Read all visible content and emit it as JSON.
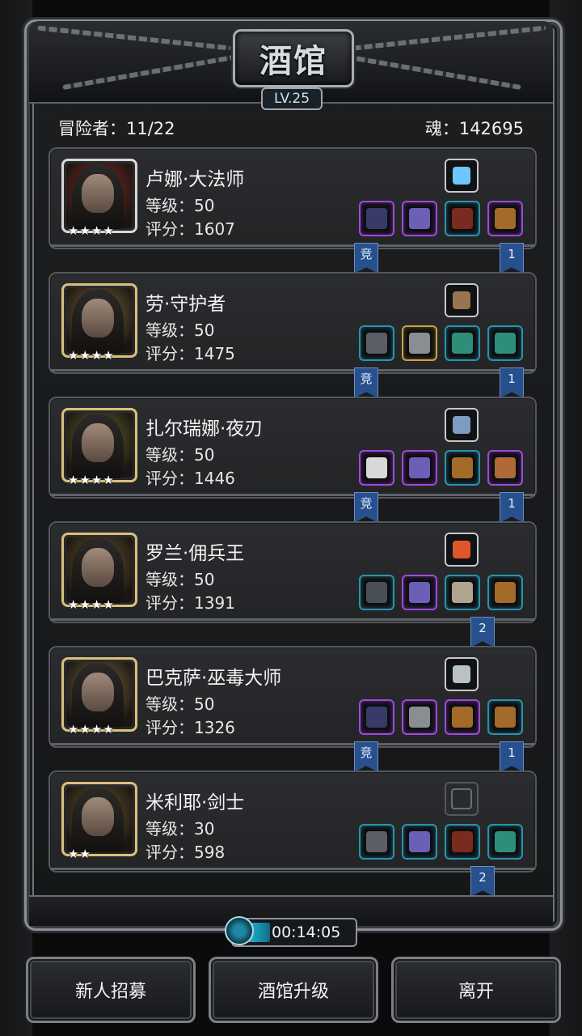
{
  "title": "酒馆",
  "tavern_level": "LV.25",
  "adventurers_label": "冒险者：11/22",
  "soul_label": "魂：142695",
  "stars_glyph": "★",
  "tags": {
    "arena": "竞"
  },
  "heroes": [
    {
      "name": "卢娜·大法师",
      "level": "等级：50",
      "score": "评分：1607",
      "stars": "★★★★",
      "portrait_bg": "#8a2a22",
      "frame_color": "#d8d8d8",
      "skill": "ice-crystal-icon",
      "skill_color": "#6ec6ff",
      "equip": [
        {
          "rarity": "purple",
          "icon": "staff-icon",
          "color": "#3a3a6a"
        },
        {
          "rarity": "purple",
          "icon": "armor-icon",
          "color": "#6b5fb8"
        },
        {
          "rarity": "teal",
          "icon": "amulet-icon",
          "color": "#7a2a1f"
        },
        {
          "rarity": "purple",
          "icon": "chest-icon",
          "color": "#a36a2a"
        }
      ],
      "arena_tag": true,
      "rank_tag": "1"
    },
    {
      "name": "劳·守护者",
      "level": "等级：50",
      "score": "评分：1475",
      "stars": "★★★★",
      "portrait_bg": "#7a6a3a",
      "frame_color": "#d9c07a",
      "skill": "gauntlet-icon",
      "skill_color": "#9a7450",
      "equip": [
        {
          "rarity": "teal",
          "icon": "sword-icon",
          "color": "#5a5f66"
        },
        {
          "rarity": "gold",
          "icon": "armor-icon",
          "color": "#8a8d92"
        },
        {
          "rarity": "teal",
          "icon": "ring-icon",
          "color": "#2f8e7a"
        },
        {
          "rarity": "teal",
          "icon": "ring-icon",
          "color": "#2f8e7a"
        }
      ],
      "arena_tag": true,
      "rank_tag": "1"
    },
    {
      "name": "扎尔瑞娜·夜刃",
      "level": "等级：50",
      "score": "评分：1446",
      "stars": "★★★★",
      "portrait_bg": "#6a6a2a",
      "frame_color": "#d9c07a",
      "skill": "book-icon",
      "skill_color": "#7d9cc2",
      "equip": [
        {
          "rarity": "purple",
          "icon": "blade-icon",
          "color": "#d8d8d8"
        },
        {
          "rarity": "purple",
          "icon": "armor-icon",
          "color": "#6b5fb8"
        },
        {
          "rarity": "teal",
          "icon": "chest-icon",
          "color": "#a36a2a"
        },
        {
          "rarity": "purple",
          "icon": "scroll-icon",
          "color": "#b06a3a"
        }
      ],
      "arena_tag": true,
      "rank_tag": "1"
    },
    {
      "name": "罗兰·佣兵王",
      "level": "等级：50",
      "score": "评分：1391",
      "stars": "★★★★",
      "portrait_bg": "#6a5a2a",
      "frame_color": "#d9c07a",
      "skill": "fire-orb-icon",
      "skill_color": "#e0562a",
      "equip": [
        {
          "rarity": "teal",
          "icon": "dagger-icon",
          "color": "#4a4f56"
        },
        {
          "rarity": "purple",
          "icon": "armor-icon",
          "color": "#6b5fb8"
        },
        {
          "rarity": "teal",
          "icon": "claw-icon",
          "color": "#b0a490"
        },
        {
          "rarity": "teal",
          "icon": "chest-icon",
          "color": "#a36a2a"
        }
      ],
      "arena_tag": false,
      "rank_tag": "2"
    },
    {
      "name": "巴克萨·巫毒大师",
      "level": "等级：50",
      "score": "评分：1326",
      "stars": "★★★★",
      "portrait_bg": "#7a6a3a",
      "frame_color": "#d9c07a",
      "skill": "knife-icon",
      "skill_color": "#b8c0c8",
      "equip": [
        {
          "rarity": "purple",
          "icon": "staff-icon",
          "color": "#3a3a6a"
        },
        {
          "rarity": "purple",
          "icon": "armor-icon",
          "color": "#8a8d92"
        },
        {
          "rarity": "purple",
          "icon": "chest-icon",
          "color": "#a36a2a"
        },
        {
          "rarity": "teal",
          "icon": "chest-icon",
          "color": "#a36a2a"
        }
      ],
      "arena_tag": true,
      "rank_tag": "1"
    },
    {
      "name": "米利耶·剑士",
      "level": "等级：30",
      "score": "评分：598",
      "stars": "★★",
      "portrait_bg": "#6a5a2a",
      "frame_color": "#d9c07a",
      "skill": "empty-slot-icon",
      "skill_color": "#6a6d72",
      "equip": [
        {
          "rarity": "teal",
          "icon": "sword-icon",
          "color": "#5a5f66"
        },
        {
          "rarity": "teal",
          "icon": "armor-icon",
          "color": "#6b5fb8"
        },
        {
          "rarity": "teal",
          "icon": "amulet-icon",
          "color": "#7a2a1f"
        },
        {
          "rarity": "teal",
          "icon": "ring-icon",
          "color": "#2f8e7a"
        }
      ],
      "arena_tag": false,
      "rank_tag": "2"
    }
  ],
  "timer": "00:14:05",
  "buttons": {
    "recruit": "新人招募",
    "upgrade": "酒馆升级",
    "leave": "离开"
  }
}
